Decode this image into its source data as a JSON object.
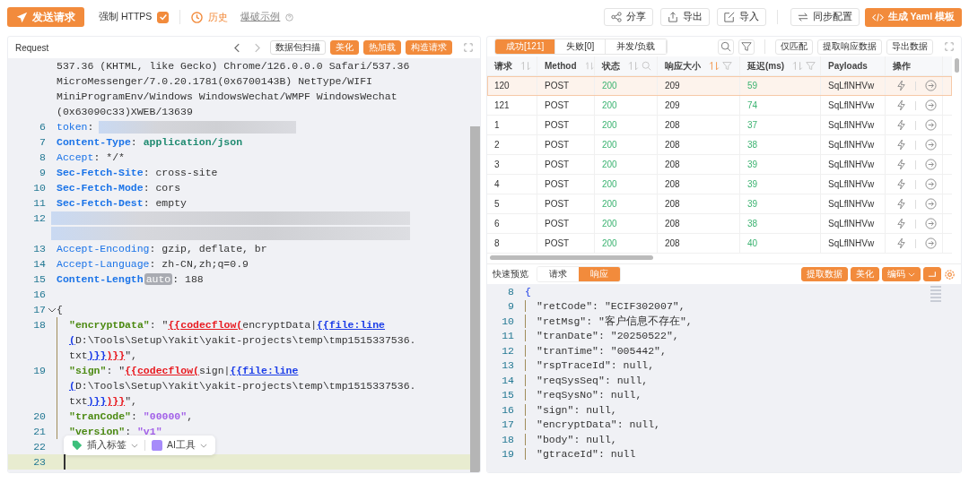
{
  "toolbar": {
    "send_button": "发送请求",
    "force_https": {
      "label": "强制 HTTPS",
      "checked": true
    },
    "history": "历史",
    "example_link": "爆破示例",
    "buttons": [
      "分享",
      "导出",
      "导入",
      "同步配置"
    ],
    "primary_button": "生成 Yaml 模板"
  },
  "request_panel": {
    "title": "Request",
    "buttons": [
      {
        "label": "数据包扫描",
        "kind": "outline"
      },
      {
        "label": "美化",
        "kind": "primary"
      },
      {
        "label": "热加载",
        "kind": "primary"
      },
      {
        "label": "构造请求",
        "kind": "primary"
      }
    ],
    "lines": [
      {
        "parts": [
          {
            "text": "537.36 (KHTML, like Gecko) Chrome/126.0.0.0 Safari/537.36",
            "kind": "value"
          }
        ]
      },
      {
        "parts": [
          {
            "text": "MicroMessenger/7.0.20.1781(0x6700143B) NetType/WIFI",
            "kind": "value"
          }
        ]
      },
      {
        "parts": [
          {
            "text": "MiniProgramEnv/Windows WindowsWechat/WMPF WindowsWechat",
            "kind": "value"
          }
        ]
      },
      {
        "parts": [
          {
            "text": "(0x63090c33)XWEB/13639",
            "kind": "value"
          }
        ]
      },
      {
        "no": "6",
        "parts": [
          {
            "text": "token",
            "kind": "key"
          },
          {
            "text": ":",
            "kind": "value"
          },
          {
            "kind": "masked"
          }
        ]
      },
      {
        "no": "7",
        "parts": [
          {
            "text": "Content-Type",
            "kind": "strong-key"
          },
          {
            "text": ": ",
            "kind": "value"
          },
          {
            "text": "application/json",
            "kind": "mime"
          }
        ]
      },
      {
        "no": "8",
        "parts": [
          {
            "text": "Accept",
            "kind": "key"
          },
          {
            "text": ": */*",
            "kind": "value"
          }
        ]
      },
      {
        "no": "9",
        "parts": [
          {
            "text": "Sec-Fetch-Site",
            "kind": "strong-key"
          },
          {
            "text": ": cross-site",
            "kind": "value"
          }
        ]
      },
      {
        "no": "10",
        "parts": [
          {
            "text": "Sec-Fetch-Mode",
            "kind": "strong-key"
          },
          {
            "text": ": cors",
            "kind": "value"
          }
        ]
      },
      {
        "no": "11",
        "parts": [
          {
            "text": "Sec-Fetch-Dest",
            "kind": "strong-key"
          },
          {
            "text": ": empty",
            "kind": "value"
          }
        ]
      },
      {
        "no": "12",
        "parts": [
          {
            "kind": "masked-block"
          }
        ]
      },
      {
        "parts": [
          {
            "kind": "masked-block"
          }
        ]
      },
      {
        "no": "13",
        "parts": [
          {
            "text": "Accept-Encoding",
            "kind": "key"
          },
          {
            "text": ": gzip, deflate, br",
            "kind": "value"
          }
        ]
      },
      {
        "no": "14",
        "parts": [
          {
            "text": "Accept-Language",
            "kind": "key"
          },
          {
            "text": ": zh-CN,zh;q=0.9",
            "kind": "value"
          }
        ]
      },
      {
        "no": "15",
        "parts": [
          {
            "text": "Content-Length",
            "kind": "strong-key"
          },
          {
            "text": "auto",
            "kind": "badge"
          },
          {
            "text": ": 188",
            "kind": "value"
          }
        ]
      },
      {
        "no": "16"
      },
      {
        "no": "17",
        "fold": true,
        "parts": [
          {
            "text": "{",
            "kind": "value"
          }
        ]
      },
      {
        "no": "18",
        "parts": [
          {
            "text": "\"encryptData\"",
            "kind": "json-key"
          },
          {
            "text": ": \"",
            "kind": "value"
          },
          {
            "text": "{{codecflow(",
            "kind": "func"
          },
          {
            "text": "encryptData|",
            "kind": "value"
          },
          {
            "text": "{{file:line",
            "kind": "tag"
          }
        ]
      },
      {
        "parts": [
          {
            "text": "(",
            "kind": "tag"
          },
          {
            "text": "D:\\Tools\\Setup\\Yakit\\yakit-projects\\temp\\tmp1515337536.",
            "kind": "value"
          }
        ]
      },
      {
        "parts": [
          {
            "text": "txt",
            "kind": "value"
          },
          {
            "text": ")}}",
            "kind": "tag"
          },
          {
            "text": ")}}",
            "kind": "func"
          },
          {
            "text": "\",",
            "kind": "value"
          }
        ]
      },
      {
        "no": "19",
        "parts": [
          {
            "text": "\"sign\"",
            "kind": "json-key"
          },
          {
            "text": ": \"",
            "kind": "value"
          },
          {
            "text": "{{codecflow(",
            "kind": "func"
          },
          {
            "text": "sign|",
            "kind": "value"
          },
          {
            "text": "{{file:line",
            "kind": "tag"
          }
        ]
      },
      {
        "parts": [
          {
            "text": "(",
            "kind": "tag"
          },
          {
            "text": "D:\\Tools\\Setup\\Yakit\\yakit-projects\\temp\\tmp1515337536.",
            "kind": "value"
          }
        ]
      },
      {
        "parts": [
          {
            "text": "txt",
            "kind": "value"
          },
          {
            "text": ")}}",
            "kind": "tag"
          },
          {
            "text": ")}}",
            "kind": "func"
          },
          {
            "text": "\",",
            "kind": "value"
          }
        ]
      },
      {
        "no": "20",
        "parts": [
          {
            "text": "\"tranCode\"",
            "kind": "json-key"
          },
          {
            "text": ": ",
            "kind": "value"
          },
          {
            "text": "\"00000\"",
            "kind": "number"
          },
          {
            "text": ",",
            "kind": "value"
          }
        ]
      },
      {
        "no": "21",
        "parts": [
          {
            "text": "\"version\"",
            "kind": "json-key"
          },
          {
            "text": ": ",
            "kind": "value"
          },
          {
            "text": "\"v1\"",
            "kind": "number"
          }
        ]
      },
      {
        "no": "22"
      },
      {
        "no": "23",
        "current": true
      }
    ],
    "float_toolbar": [
      "插入标签",
      "AI工具"
    ]
  },
  "results_panel": {
    "tabs": [
      {
        "label": "成功[121]",
        "selected": true
      },
      {
        "label": "失败[0]",
        "selected": false
      },
      {
        "label": "并发/负载",
        "selected": false
      }
    ],
    "buttons": [
      "仅匹配",
      "提取响应数据",
      "导出数据"
    ],
    "columns": [
      {
        "label": "请求",
        "sort": true
      },
      {
        "label": "Method",
        "sort": true
      },
      {
        "label": "状态",
        "sort": true,
        "search": true,
        "kind": "success"
      },
      {
        "label": "响应大小",
        "sort": true,
        "sort_active": true,
        "filter": true
      },
      {
        "label": "延迟(ms)",
        "sort": true,
        "filter": true,
        "kind": "success"
      },
      {
        "label": "Payloads"
      },
      {
        "label": "操作"
      }
    ],
    "rows": [
      {
        "selected": true,
        "cells": [
          "120",
          "POST",
          "200",
          "209",
          "59",
          "SqLflNHVw"
        ]
      },
      {
        "selected": false,
        "cells": [
          "121",
          "POST",
          "200",
          "209",
          "74",
          "SqLflNHVw"
        ]
      },
      {
        "selected": false,
        "cells": [
          "1",
          "POST",
          "200",
          "208",
          "37",
          "SqLflNHVw"
        ]
      },
      {
        "selected": false,
        "cells": [
          "2",
          "POST",
          "200",
          "208",
          "38",
          "SqLflNHVw"
        ]
      },
      {
        "selected": false,
        "cells": [
          "3",
          "POST",
          "200",
          "208",
          "39",
          "SqLflNHVw"
        ]
      },
      {
        "selected": false,
        "cells": [
          "4",
          "POST",
          "200",
          "208",
          "39",
          "SqLflNHVw"
        ]
      },
      {
        "selected": false,
        "cells": [
          "5",
          "POST",
          "200",
          "208",
          "39",
          "SqLflNHVw"
        ]
      },
      {
        "selected": false,
        "cells": [
          "6",
          "POST",
          "200",
          "208",
          "38",
          "SqLflNHVw"
        ]
      },
      {
        "selected": false,
        "cells": [
          "8",
          "POST",
          "200",
          "208",
          "40",
          "SqLflNHVw"
        ]
      }
    ]
  },
  "preview": {
    "label": "快速预览",
    "tabs": [
      {
        "label": "请求",
        "selected": false
      },
      {
        "label": "响应",
        "selected": true
      }
    ],
    "buttons": [
      {
        "label": "提取数据",
        "dropdown": false
      },
      {
        "label": "美化",
        "dropdown": false
      },
      {
        "label": "编码",
        "dropdown": true
      }
    ],
    "lines": [
      {
        "no": "8",
        "text": "{",
        "kind": "brace"
      },
      {
        "no": "9",
        "text": "\"retCode\": \"ECIF302007\",",
        "kind": "entry"
      },
      {
        "no": "10",
        "text": "\"retMsg\": \"客户信息不存在\",",
        "kind": "entry"
      },
      {
        "no": "11",
        "text": "\"tranDate\": \"20250522\",",
        "kind": "entry"
      },
      {
        "no": "12",
        "text": "\"tranTime\": \"005442\",",
        "kind": "entry"
      },
      {
        "no": "13",
        "text": "\"rspTraceId\": null,",
        "kind": "entry"
      },
      {
        "no": "14",
        "text": "\"reqSysSeq\": null,",
        "kind": "entry"
      },
      {
        "no": "15",
        "text": "\"reqSysNo\": null,",
        "kind": "entry"
      },
      {
        "no": "16",
        "text": "\"sign\": null,",
        "kind": "entry"
      },
      {
        "no": "17",
        "text": "\"encryptData\": null,",
        "kind": "entry"
      },
      {
        "no": "18",
        "text": "\"body\": null,",
        "kind": "entry"
      },
      {
        "no": "19",
        "text": "\"gtraceId\": null",
        "kind": "entry"
      }
    ]
  }
}
